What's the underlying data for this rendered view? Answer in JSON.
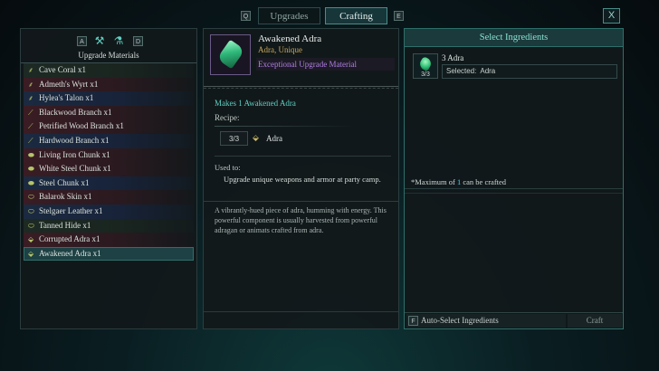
{
  "topbar": {
    "key_left": "Q",
    "key_right": "E",
    "tabs": [
      {
        "label": "Upgrades",
        "active": false
      },
      {
        "label": "Crafting",
        "active": true
      }
    ],
    "close_label": "X"
  },
  "materials_panel": {
    "key_prev": "A",
    "key_next": "D",
    "icons": [
      "anvil-icon",
      "potion-icon"
    ],
    "title": "Upgrade Materials",
    "items": [
      {
        "label": "Cave Coral x1",
        "tint": "green",
        "icon": "coral-icon"
      },
      {
        "label": "Admeth's Wyrt x1",
        "tint": "red",
        "icon": "herb-icon"
      },
      {
        "label": "Hylea's Talon x1",
        "tint": "blue",
        "icon": "talon-icon"
      },
      {
        "label": "Blackwood Branch x1",
        "tint": "red",
        "icon": "branch-icon"
      },
      {
        "label": "Petrified Wood Branch x1",
        "tint": "red",
        "icon": "branch-icon"
      },
      {
        "label": "Hardwood Branch x1",
        "tint": "blue",
        "icon": "branch-icon"
      },
      {
        "label": "Living Iron Chunk x1",
        "tint": "red",
        "icon": "ore-icon"
      },
      {
        "label": "White Steel Chunk x1",
        "tint": "red",
        "icon": "ore-icon"
      },
      {
        "label": "Steel Chunk x1",
        "tint": "blue",
        "icon": "ore-icon"
      },
      {
        "label": "Balarok Skin x1",
        "tint": "red",
        "icon": "hide-icon"
      },
      {
        "label": "Stelgaer Leather x1",
        "tint": "blue",
        "icon": "hide-icon"
      },
      {
        "label": "Tanned Hide x1",
        "tint": "green",
        "icon": "hide-icon"
      },
      {
        "label": "Corrupted Adra x1",
        "tint": "red",
        "icon": "adra-icon"
      },
      {
        "label": "Awakened Adra x1",
        "tint": "selected",
        "icon": "adra-icon"
      }
    ]
  },
  "detail_panel": {
    "item_name": "Awakened Adra",
    "item_subtitle": "Adra, Unique",
    "item_type": "Exceptional Upgrade Material",
    "makes": "Makes 1 Awakened Adra",
    "recipe_label": "Recipe:",
    "recipe": {
      "count": "3/3",
      "ingredient": "Adra"
    },
    "used_to_label": "Used to:",
    "used_to_text": "Upgrade unique weapons and armor at party camp.",
    "description": "A vibrantly-hued piece of adra, humming with energy. This powerful component is usually harvested from powerful adragan or animats crafted from adra."
  },
  "ingredients_panel": {
    "title": "Select Ingredients",
    "ingredient_name": "3 Adra",
    "ingredient_count": "3/3",
    "selected_label": "Selected:",
    "selected_value": "Adra",
    "max_note_prefix": "*Maximum of ",
    "max_note_num": "1",
    "max_note_suffix": " can be crafted",
    "auto_key": "F",
    "auto_label": "Auto-Select Ingredients",
    "craft_label": "Craft"
  },
  "colors": {
    "accent": "#5fd0c3",
    "unique_gold": "#c7a85c",
    "exceptional_purple": "#b07fe6"
  }
}
